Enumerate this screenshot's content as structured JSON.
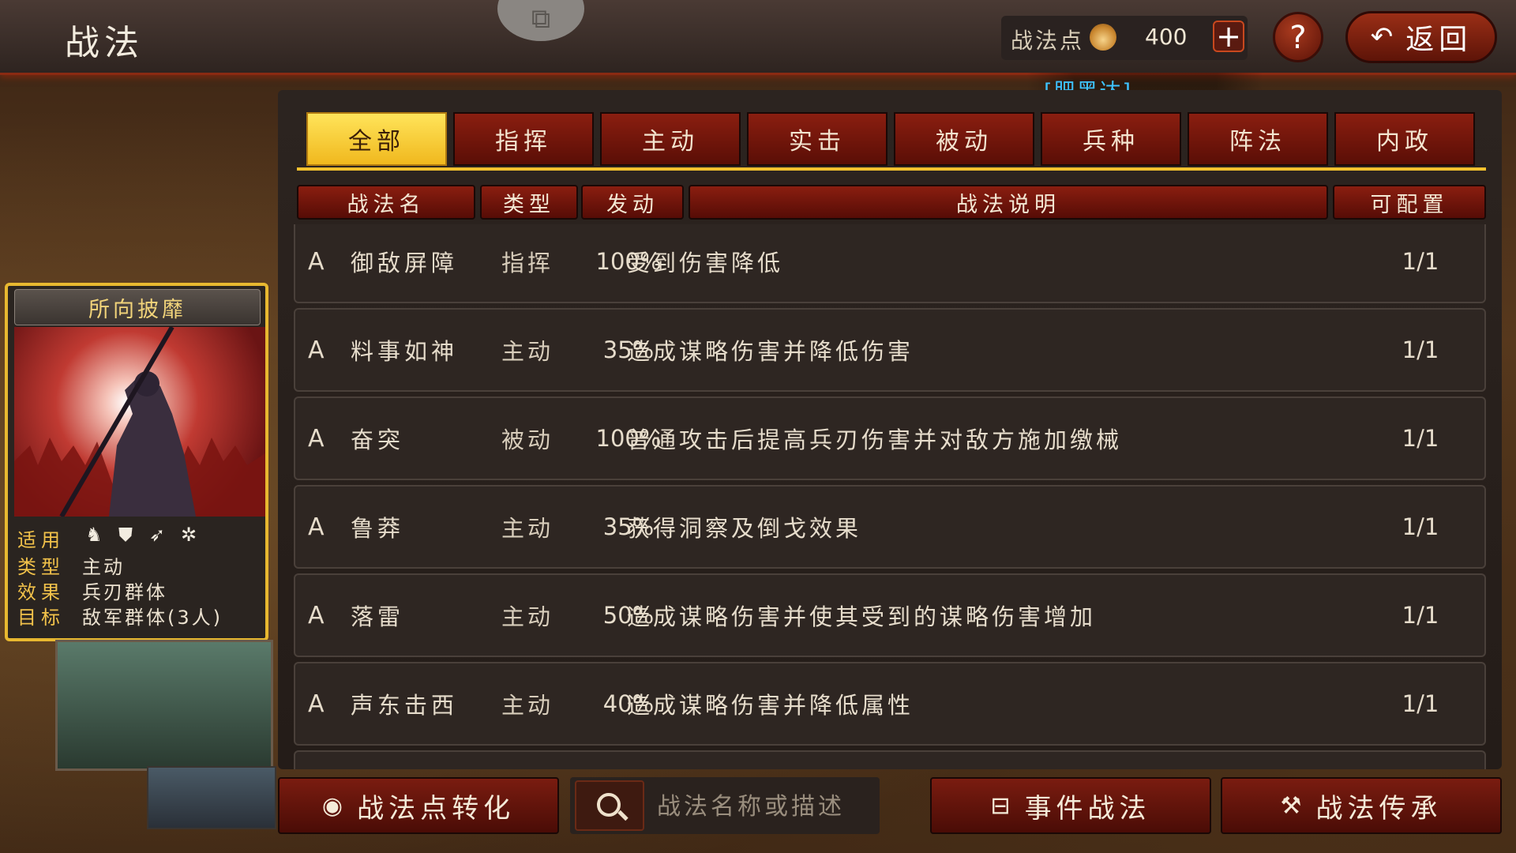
{
  "header": {
    "title": "战法",
    "points_label": "战法点",
    "points_value": "400",
    "plus_label": "+",
    "help_label": "?",
    "back_label": "返回"
  },
  "marquee": {
    "text": "[肥黑达]"
  },
  "tabs": [
    {
      "label": "全部",
      "active": true
    },
    {
      "label": "指挥"
    },
    {
      "label": "主动"
    },
    {
      "label": "实击"
    },
    {
      "label": "被动"
    },
    {
      "label": "兵种"
    },
    {
      "label": "阵法"
    },
    {
      "label": "内政"
    }
  ],
  "table": {
    "headers": [
      "战法名",
      "类型",
      "发动",
      "战法说明",
      "可配置"
    ],
    "rows": [
      {
        "grade": "A",
        "name": "御敌屏障",
        "type": "指挥",
        "rate": "100%",
        "desc": "受到伤害降低",
        "config": "1/1"
      },
      {
        "grade": "A",
        "name": "料事如神",
        "type": "主动",
        "rate": "35%",
        "desc": "造成谋略伤害并降低伤害",
        "config": "1/1"
      },
      {
        "grade": "A",
        "name": "奋突",
        "type": "被动",
        "rate": "100%",
        "desc": "普通攻击后提高兵刃伤害并对敌方施加缴械",
        "config": "1/1"
      },
      {
        "grade": "A",
        "name": "鲁莽",
        "type": "主动",
        "rate": "35%",
        "desc": "获得洞察及倒戈效果",
        "config": "1/1"
      },
      {
        "grade": "A",
        "name": "落雷",
        "type": "主动",
        "rate": "50%",
        "desc": "造成谋略伤害并使其受到的谋略伤害增加",
        "config": "1/1"
      },
      {
        "grade": "A",
        "name": "声东击西",
        "type": "主动",
        "rate": "40%",
        "desc": "造成谋略伤害并降低属性",
        "config": "1/1"
      }
    ]
  },
  "card": {
    "title": "所向披靡",
    "apply_label": "适用",
    "troop_icons": [
      "cavalry-icon",
      "shield-icon",
      "archer-icon",
      "chariot-icon"
    ],
    "type_label": "类型",
    "type_value": "主动",
    "effect_label": "效果",
    "effect_value": "兵刃群体",
    "target_label": "目标",
    "target_value": "敌军群体(3人)"
  },
  "bottom": {
    "convert_label": "战法点转化",
    "search_placeholder": "战法名称或描述",
    "event_label": "事件战法",
    "inherit_label": "战法传承"
  },
  "colors": {
    "accent_red": "#8a1e10",
    "active_tab": "#f0b81e",
    "card_border": "#e8b830",
    "marquee_text": "#3ec3ff"
  }
}
